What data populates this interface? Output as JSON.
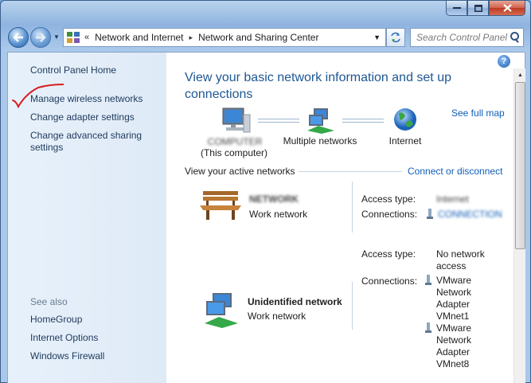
{
  "window": {
    "caption_buttons": [
      "minimize",
      "maximize",
      "close"
    ]
  },
  "address_bar": {
    "breadcrumb_sep": "«",
    "crumbs": [
      "Network and Internet",
      "Network and Sharing Center"
    ],
    "crumb_arrow": "▸"
  },
  "search": {
    "placeholder": "Search Control Panel"
  },
  "sidebar": {
    "items": [
      {
        "label": "Control Panel Home"
      },
      {
        "label": "Manage wireless networks"
      },
      {
        "label": "Change adapter settings"
      },
      {
        "label": "Change advanced sharing settings"
      }
    ],
    "see_also_label": "See also",
    "see_also": [
      {
        "label": "HomeGroup"
      },
      {
        "label": "Internet Options"
      },
      {
        "label": "Windows Firewall"
      }
    ]
  },
  "main": {
    "title": "View your basic network information and set up connections",
    "see_full_map": "See full map",
    "map": {
      "computer_name": "COMPUTER",
      "computer_caption": "(This computer)",
      "middle_label": "Multiple networks",
      "internet_label": "Internet"
    },
    "active_networks_heading": "View your active networks",
    "connect_link": "Connect or disconnect",
    "networks": [
      {
        "name": "NETWORK",
        "type_link": "Work network",
        "access_type_label": "Access type:",
        "access_type": "Internet",
        "connections_label": "Connections:",
        "connections": [
          "CONNECTION"
        ]
      },
      {
        "name": "Unidentified network",
        "type": "Work network",
        "access_type_label": "Access type:",
        "access_type": "No network access",
        "connections_label": "Connections:",
        "connections": [
          "VMware Network Adapter VMnet1",
          "VMware Network Adapter VMnet8"
        ]
      }
    ]
  },
  "colors": {
    "title_blue": "#1e5794",
    "link_blue": "#0f5fb8",
    "sidebar_bg": "#e7f1fb",
    "annotation_red": "#d62020"
  },
  "icons": [
    "back-arrow-icon",
    "forward-arrow-icon",
    "control-panel-icon",
    "refresh-icon",
    "search-icon",
    "help-icon",
    "computer-icon",
    "network-icon",
    "globe-icon",
    "bench-icon",
    "adapter-icon"
  ]
}
